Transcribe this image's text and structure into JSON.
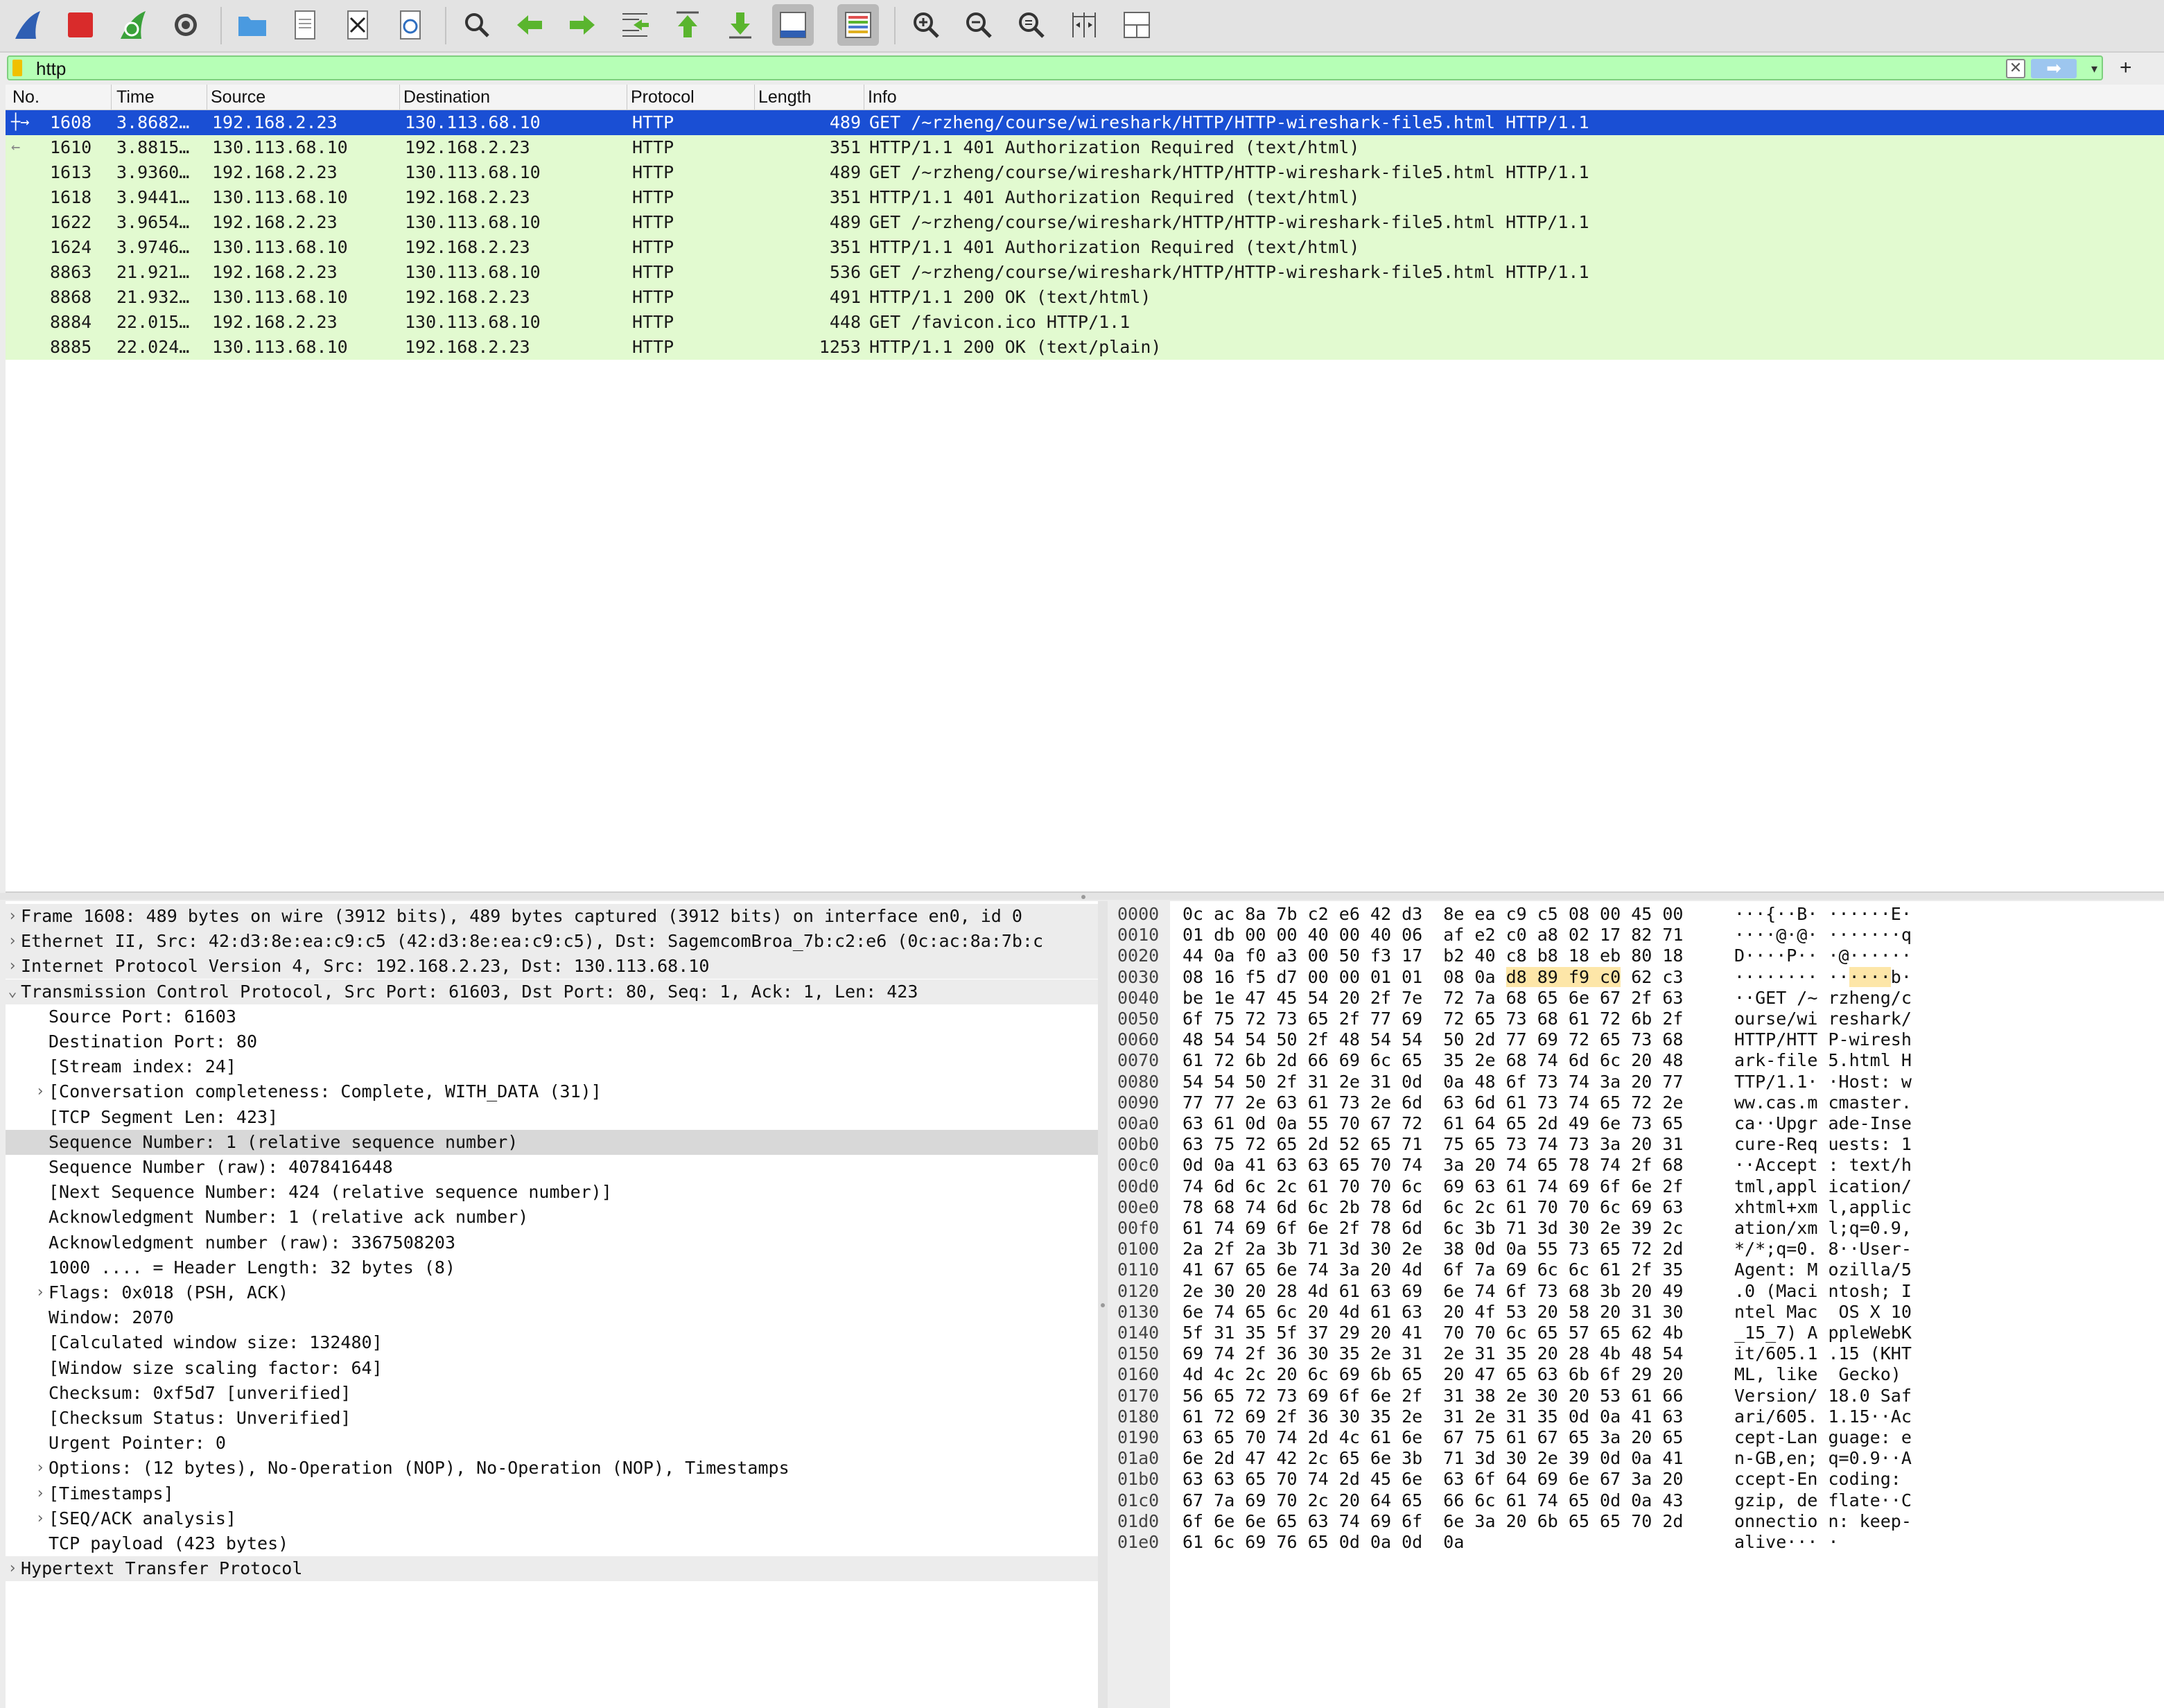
{
  "toolbar": {
    "buttons": [
      {
        "name": "start-capture-button",
        "icon": "shark-fin-icon"
      },
      {
        "name": "stop-capture-button",
        "icon": "stop-icon"
      },
      {
        "name": "restart-capture-button",
        "icon": "restart-fin-icon"
      },
      {
        "name": "capture-options-button",
        "icon": "gear-icon"
      },
      {
        "name": "open-file-button",
        "icon": "folder-icon"
      },
      {
        "name": "save-file-button",
        "icon": "document-icon"
      },
      {
        "name": "close-file-button",
        "icon": "close-file-icon"
      },
      {
        "name": "reload-file-button",
        "icon": "reload-icon"
      },
      {
        "name": "find-packet-button",
        "icon": "magnifier-icon"
      },
      {
        "name": "go-back-button",
        "icon": "arrow-left-icon"
      },
      {
        "name": "go-forward-button",
        "icon": "arrow-right-icon"
      },
      {
        "name": "go-to-packet-button",
        "icon": "jump-icon"
      },
      {
        "name": "first-packet-button",
        "icon": "arrow-up-icon"
      },
      {
        "name": "last-packet-button",
        "icon": "arrow-down-icon"
      },
      {
        "name": "auto-scroll-button",
        "icon": "autoscroll-icon"
      },
      {
        "name": "colorize-button",
        "icon": "colorize-icon"
      },
      {
        "name": "zoom-in-button",
        "icon": "zoom-in-icon"
      },
      {
        "name": "zoom-out-button",
        "icon": "zoom-out-icon"
      },
      {
        "name": "normal-size-button",
        "icon": "zoom-reset-icon"
      },
      {
        "name": "resize-columns-button",
        "icon": "resize-columns-icon"
      },
      {
        "name": "layout-button",
        "icon": "layout-icon"
      }
    ]
  },
  "filter": {
    "value": "http",
    "clear_label": "✕",
    "apply_label": "➡",
    "dropdown_label": "▾",
    "add_label": "+"
  },
  "columns": {
    "no": "No.",
    "time": "Time",
    "source": "Source",
    "destination": "Destination",
    "protocol": "Protocol",
    "length": "Length",
    "info": "Info"
  },
  "packets": [
    {
      "no": "1608",
      "time": "3.8682…",
      "src": "192.168.2.23",
      "dst": "130.113.68.10",
      "proto": "HTTP",
      "len": "489",
      "info": "GET /~rzheng/course/wireshark/HTTP/HTTP-wireshark-file5.html HTTP/1.1"
    },
    {
      "no": "1610",
      "time": "3.8815…",
      "src": "130.113.68.10",
      "dst": "192.168.2.23",
      "proto": "HTTP",
      "len": "351",
      "info": "HTTP/1.1 401 Authorization Required  (text/html)"
    },
    {
      "no": "1613",
      "time": "3.9360…",
      "src": "192.168.2.23",
      "dst": "130.113.68.10",
      "proto": "HTTP",
      "len": "489",
      "info": "GET /~rzheng/course/wireshark/HTTP/HTTP-wireshark-file5.html HTTP/1.1"
    },
    {
      "no": "1618",
      "time": "3.9441…",
      "src": "130.113.68.10",
      "dst": "192.168.2.23",
      "proto": "HTTP",
      "len": "351",
      "info": "HTTP/1.1 401 Authorization Required  (text/html)"
    },
    {
      "no": "1622",
      "time": "3.9654…",
      "src": "192.168.2.23",
      "dst": "130.113.68.10",
      "proto": "HTTP",
      "len": "489",
      "info": "GET /~rzheng/course/wireshark/HTTP/HTTP-wireshark-file5.html HTTP/1.1"
    },
    {
      "no": "1624",
      "time": "3.9746…",
      "src": "130.113.68.10",
      "dst": "192.168.2.23",
      "proto": "HTTP",
      "len": "351",
      "info": "HTTP/1.1 401 Authorization Required  (text/html)"
    },
    {
      "no": "8863",
      "time": "21.921…",
      "src": "192.168.2.23",
      "dst": "130.113.68.10",
      "proto": "HTTP",
      "len": "536",
      "info": "GET /~rzheng/course/wireshark/HTTP/HTTP-wireshark-file5.html HTTP/1.1"
    },
    {
      "no": "8868",
      "time": "21.932…",
      "src": "130.113.68.10",
      "dst": "192.168.2.23",
      "proto": "HTTP",
      "len": "491",
      "info": "HTTP/1.1 200 OK  (text/html)"
    },
    {
      "no": "8884",
      "time": "22.015…",
      "src": "192.168.2.23",
      "dst": "130.113.68.10",
      "proto": "HTTP",
      "len": "448",
      "info": "GET /favicon.ico HTTP/1.1"
    },
    {
      "no": "8885",
      "time": "22.024…",
      "src": "130.113.68.10",
      "dst": "192.168.2.23",
      "proto": "HTTP",
      "len": "1253",
      "info": "HTTP/1.1 200 OK  (text/plain)"
    }
  ],
  "details": [
    {
      "level": 0,
      "arrow": ">",
      "text": "Frame 1608: 489 bytes on wire (3912 bits), 489 bytes captured (3912 bits) on interface en0, id 0"
    },
    {
      "level": 0,
      "arrow": ">",
      "text": "Ethernet II, Src: 42:d3:8e:ea:c9:c5 (42:d3:8e:ea:c9:c5), Dst: SagemcomBroa_7b:c2:e6 (0c:ac:8a:7b:c"
    },
    {
      "level": 0,
      "arrow": ">",
      "text": "Internet Protocol Version 4, Src: 192.168.2.23, Dst: 130.113.68.10"
    },
    {
      "level": 0,
      "arrow": "v",
      "text": "Transmission Control Protocol, Src Port: 61603, Dst Port: 80, Seq: 1, Ack: 1, Len: 423"
    },
    {
      "level": 1,
      "arrow": "",
      "text": "Source Port: 61603"
    },
    {
      "level": 1,
      "arrow": "",
      "text": "Destination Port: 80"
    },
    {
      "level": 1,
      "arrow": "",
      "text": "[Stream index: 24]"
    },
    {
      "level": 1,
      "arrow": ">",
      "text": "[Conversation completeness: Complete, WITH_DATA (31)]"
    },
    {
      "level": 1,
      "arrow": "",
      "text": "[TCP Segment Len: 423]"
    },
    {
      "level": 1,
      "arrow": "",
      "text": "Sequence Number: 1    (relative sequence number)",
      "selected": true
    },
    {
      "level": 1,
      "arrow": "",
      "text": "Sequence Number (raw): 4078416448"
    },
    {
      "level": 1,
      "arrow": "",
      "text": "[Next Sequence Number: 424    (relative sequence number)]"
    },
    {
      "level": 1,
      "arrow": "",
      "text": "Acknowledgment Number: 1    (relative ack number)"
    },
    {
      "level": 1,
      "arrow": "",
      "text": "Acknowledgment number (raw): 3367508203"
    },
    {
      "level": 1,
      "arrow": "",
      "text": "1000 .... = Header Length: 32 bytes (8)"
    },
    {
      "level": 1,
      "arrow": ">",
      "text": "Flags: 0x018 (PSH, ACK)"
    },
    {
      "level": 1,
      "arrow": "",
      "text": "Window: 2070"
    },
    {
      "level": 1,
      "arrow": "",
      "text": "[Calculated window size: 132480]"
    },
    {
      "level": 1,
      "arrow": "",
      "text": "[Window size scaling factor: 64]"
    },
    {
      "level": 1,
      "arrow": "",
      "text": "Checksum: 0xf5d7 [unverified]"
    },
    {
      "level": 1,
      "arrow": "",
      "text": "[Checksum Status: Unverified]"
    },
    {
      "level": 1,
      "arrow": "",
      "text": "Urgent Pointer: 0"
    },
    {
      "level": 1,
      "arrow": ">",
      "text": "Options: (12 bytes), No-Operation (NOP), No-Operation (NOP), Timestamps"
    },
    {
      "level": 1,
      "arrow": ">",
      "text": "[Timestamps]"
    },
    {
      "level": 1,
      "arrow": ">",
      "text": "[SEQ/ACK analysis]"
    },
    {
      "level": 1,
      "arrow": "",
      "text": "TCP payload (423 bytes)"
    },
    {
      "level": 0,
      "arrow": ">",
      "text": "Hypertext Transfer Protocol"
    }
  ],
  "bytes": [
    {
      "off": "0000",
      "hex": "0c ac 8a 7b c2 e6 42 d3  8e ea c9 c5 08 00 45 00",
      "asc": "···{··B· ······E·"
    },
    {
      "off": "0010",
      "hex": "01 db 00 00 40 00 40 06  af e2 c0 a8 02 17 82 71",
      "asc": "····@·@· ·······q"
    },
    {
      "off": "0020",
      "hex": "44 0a f0 a3 00 50 f3 17  b2 40 c8 b8 18 eb 80 18",
      "asc": "D····P·· ·@······"
    },
    {
      "off": "0030",
      "hex_pre": "08 16 f5 d7 00 00 01 01  08 0a ",
      "hex_hl": "d8 89 f9 c0",
      "hex_post": " 62 c3",
      "asc_pre": "········ ··",
      "asc_hl": "····",
      "asc_post": "b·"
    },
    {
      "off": "0040",
      "hex": "be 1e 47 45 54 20 2f 7e  72 7a 68 65 6e 67 2f 63",
      "asc": "··GET /~ rzheng/c"
    },
    {
      "off": "0050",
      "hex": "6f 75 72 73 65 2f 77 69  72 65 73 68 61 72 6b 2f",
      "asc": "ourse/wi reshark/"
    },
    {
      "off": "0060",
      "hex": "48 54 54 50 2f 48 54 54  50 2d 77 69 72 65 73 68",
      "asc": "HTTP/HTT P-wiresh"
    },
    {
      "off": "0070",
      "hex": "61 72 6b 2d 66 69 6c 65  35 2e 68 74 6d 6c 20 48",
      "asc": "ark-file 5.html H"
    },
    {
      "off": "0080",
      "hex": "54 54 50 2f 31 2e 31 0d  0a 48 6f 73 74 3a 20 77",
      "asc": "TTP/1.1· ·Host: w"
    },
    {
      "off": "0090",
      "hex": "77 77 2e 63 61 73 2e 6d  63 6d 61 73 74 65 72 2e",
      "asc": "ww.cas.m cmaster."
    },
    {
      "off": "00a0",
      "hex": "63 61 0d 0a 55 70 67 72  61 64 65 2d 49 6e 73 65",
      "asc": "ca··Upgr ade-Inse"
    },
    {
      "off": "00b0",
      "hex": "63 75 72 65 2d 52 65 71  75 65 73 74 73 3a 20 31",
      "asc": "cure-Req uests: 1"
    },
    {
      "off": "00c0",
      "hex": "0d 0a 41 63 63 65 70 74  3a 20 74 65 78 74 2f 68",
      "asc": "··Accept : text/h"
    },
    {
      "off": "00d0",
      "hex": "74 6d 6c 2c 61 70 70 6c  69 63 61 74 69 6f 6e 2f",
      "asc": "tml,appl ication/"
    },
    {
      "off": "00e0",
      "hex": "78 68 74 6d 6c 2b 78 6d  6c 2c 61 70 70 6c 69 63",
      "asc": "xhtml+xm l,applic"
    },
    {
      "off": "00f0",
      "hex": "61 74 69 6f 6e 2f 78 6d  6c 3b 71 3d 30 2e 39 2c",
      "asc": "ation/xm l;q=0.9,"
    },
    {
      "off": "0100",
      "hex": "2a 2f 2a 3b 71 3d 30 2e  38 0d 0a 55 73 65 72 2d",
      "asc": "*/*;q=0. 8··User-"
    },
    {
      "off": "0110",
      "hex": "41 67 65 6e 74 3a 20 4d  6f 7a 69 6c 6c 61 2f 35",
      "asc": "Agent: M ozilla/5"
    },
    {
      "off": "0120",
      "hex": "2e 30 20 28 4d 61 63 69  6e 74 6f 73 68 3b 20 49",
      "asc": ".0 (Maci ntosh; I"
    },
    {
      "off": "0130",
      "hex": "6e 74 65 6c 20 4d 61 63  20 4f 53 20 58 20 31 30",
      "asc": "ntel Mac  OS X 10"
    },
    {
      "off": "0140",
      "hex": "5f 31 35 5f 37 29 20 41  70 70 6c 65 57 65 62 4b",
      "asc": "_15_7) A ppleWebK"
    },
    {
      "off": "0150",
      "hex": "69 74 2f 36 30 35 2e 31  2e 31 35 20 28 4b 48 54",
      "asc": "it/605.1 .15 (KHT"
    },
    {
      "off": "0160",
      "hex": "4d 4c 2c 20 6c 69 6b 65  20 47 65 63 6b 6f 29 20",
      "asc": "ML, like  Gecko) "
    },
    {
      "off": "0170",
      "hex": "56 65 72 73 69 6f 6e 2f  31 38 2e 30 20 53 61 66",
      "asc": "Version/ 18.0 Saf"
    },
    {
      "off": "0180",
      "hex": "61 72 69 2f 36 30 35 2e  31 2e 31 35 0d 0a 41 63",
      "asc": "ari/605. 1.15··Ac"
    },
    {
      "off": "0190",
      "hex": "63 65 70 74 2d 4c 61 6e  67 75 61 67 65 3a 20 65",
      "asc": "cept-Lan guage: e"
    },
    {
      "off": "01a0",
      "hex": "6e 2d 47 42 2c 65 6e 3b  71 3d 30 2e 39 0d 0a 41",
      "asc": "n-GB,en; q=0.9··A"
    },
    {
      "off": "01b0",
      "hex": "63 63 65 70 74 2d 45 6e  63 6f 64 69 6e 67 3a 20",
      "asc": "ccept-En coding: "
    },
    {
      "off": "01c0",
      "hex": "67 7a 69 70 2c 20 64 65  66 6c 61 74 65 0d 0a 43",
      "asc": "gzip, de flate··C"
    },
    {
      "off": "01d0",
      "hex": "6f 6e 6e 65 63 74 69 6f  6e 3a 20 6b 65 65 70 2d",
      "asc": "onnectio n: keep-"
    },
    {
      "off": "01e0",
      "hex": "61 6c 69 76 65 0d 0a 0d  0a",
      "asc": "alive··· ·"
    }
  ]
}
